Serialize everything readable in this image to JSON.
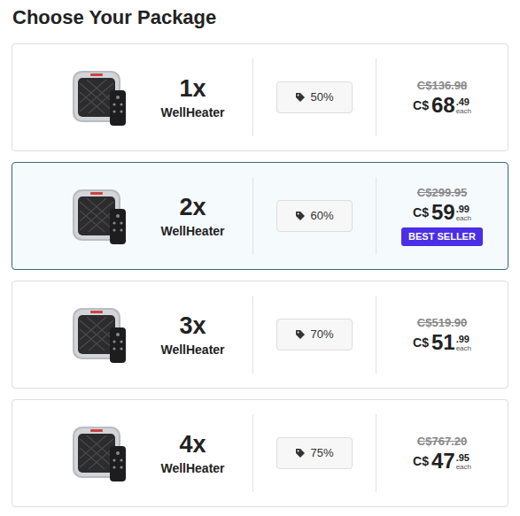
{
  "title": "Choose Your Package",
  "packages": [
    {
      "quantity": "1x",
      "name": "WellHeater",
      "discount": "50%",
      "old_price": "C$136.98",
      "currency": "C$",
      "price_whole": "68",
      "price_cents": ".49",
      "unit": "each",
      "selected": false
    },
    {
      "quantity": "2x",
      "name": "WellHeater",
      "discount": "60%",
      "old_price": "C$299.95",
      "currency": "C$",
      "price_whole": "59",
      "price_cents": ".99",
      "unit": "each",
      "badge": "BEST SELLER",
      "selected": true
    },
    {
      "quantity": "3x",
      "name": "WellHeater",
      "discount": "70%",
      "old_price": "C$519.90",
      "currency": "C$",
      "price_whole": "51",
      "price_cents": ".99",
      "unit": "each",
      "selected": false
    },
    {
      "quantity": "4x",
      "name": "WellHeater",
      "discount": "75%",
      "old_price": "C$767.20",
      "currency": "C$",
      "price_whole": "47",
      "price_cents": ".95",
      "unit": "each",
      "selected": false
    }
  ]
}
